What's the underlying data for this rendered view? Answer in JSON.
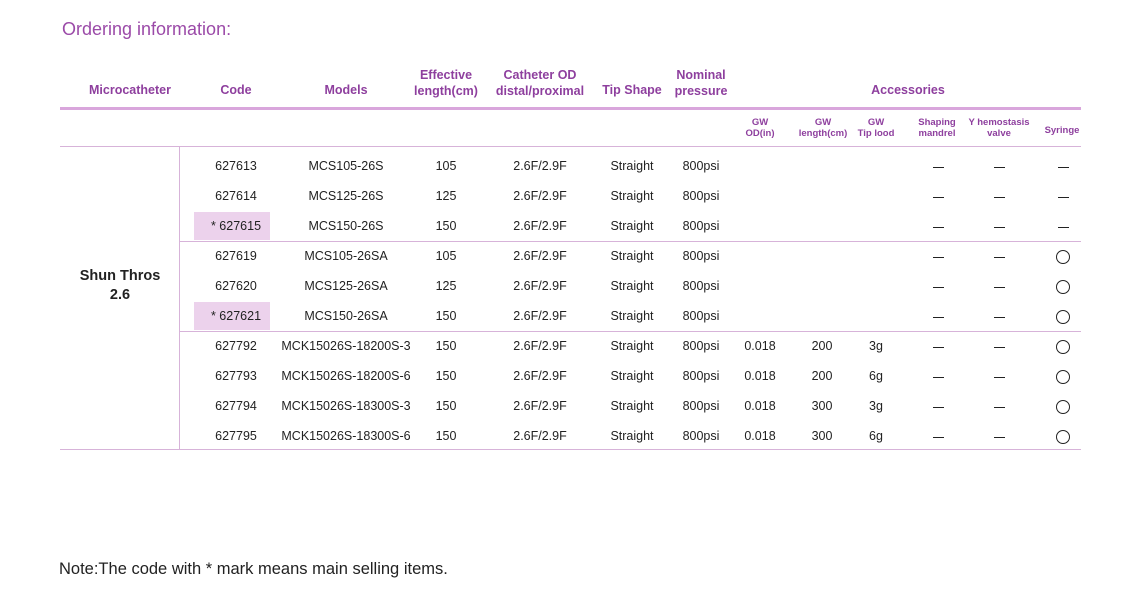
{
  "title": "Ordering information:",
  "headers": {
    "microcatheter": "Microcatheter",
    "code": "Code",
    "models": "Models",
    "effective_length": [
      "Effective",
      "length(cm)"
    ],
    "catheter_od": [
      "Catheter OD",
      "distal/proximal"
    ],
    "tip_shape": "Tip Shape",
    "nominal_pressure": [
      "Nominal",
      "pressure"
    ],
    "accessories": "Accessories"
  },
  "subheaders": {
    "gw_od": [
      "GW",
      "OD(in)"
    ],
    "gw_length": [
      "GW",
      "length(cm)"
    ],
    "gw_tip": [
      "GW",
      "Tip lood"
    ],
    "shaping": [
      "Shaping",
      "mandrel"
    ],
    "y_hemostasis": [
      "Y hemostasis",
      "valve"
    ],
    "syringe": "Syringe"
  },
  "group_label": [
    "Shun Thros",
    "2.6"
  ],
  "rows": [
    {
      "code": "627613",
      "model": "MCS105-26S",
      "length": "105",
      "od": "2.6F/2.9F",
      "tip": "Straight",
      "pressure": "800psi",
      "gw_od": "",
      "gw_len": "",
      "gw_tip": "",
      "shaping": "—",
      "yvalve": "—",
      "syringe": "—",
      "main": false
    },
    {
      "code": "627614",
      "model": "MCS125-26S",
      "length": "125",
      "od": "2.6F/2.9F",
      "tip": "Straight",
      "pressure": "800psi",
      "gw_od": "",
      "gw_len": "",
      "gw_tip": "",
      "shaping": "—",
      "yvalve": "—",
      "syringe": "—",
      "main": false
    },
    {
      "code": "* 627615",
      "model": "MCS150-26S",
      "length": "150",
      "od": "2.6F/2.9F",
      "tip": "Straight",
      "pressure": "800psi",
      "gw_od": "",
      "gw_len": "",
      "gw_tip": "",
      "shaping": "—",
      "yvalve": "—",
      "syringe": "—",
      "main": true
    },
    {
      "code": "627619",
      "model": "MCS105-26SA",
      "length": "105",
      "od": "2.6F/2.9F",
      "tip": "Straight",
      "pressure": "800psi",
      "gw_od": "",
      "gw_len": "",
      "gw_tip": "",
      "shaping": "—",
      "yvalve": "—",
      "syringe": "○",
      "main": false
    },
    {
      "code": "627620",
      "model": "MCS125-26SA",
      "length": "125",
      "od": "2.6F/2.9F",
      "tip": "Straight",
      "pressure": "800psi",
      "gw_od": "",
      "gw_len": "",
      "gw_tip": "",
      "shaping": "—",
      "yvalve": "—",
      "syringe": "○",
      "main": false
    },
    {
      "code": "* 627621",
      "model": "MCS150-26SA",
      "length": "150",
      "od": "2.6F/2.9F",
      "tip": "Straight",
      "pressure": "800psi",
      "gw_od": "",
      "gw_len": "",
      "gw_tip": "",
      "shaping": "—",
      "yvalve": "—",
      "syringe": "○",
      "main": true
    },
    {
      "code": "627792",
      "model": "MCK15026S-18200S-3",
      "length": "150",
      "od": "2.6F/2.9F",
      "tip": "Straight",
      "pressure": "800psi",
      "gw_od": "0.018",
      "gw_len": "200",
      "gw_tip": "3g",
      "shaping": "—",
      "yvalve": "—",
      "syringe": "○",
      "main": false
    },
    {
      "code": "627793",
      "model": "MCK15026S-18200S-6",
      "length": "150",
      "od": "2.6F/2.9F",
      "tip": "Straight",
      "pressure": "800psi",
      "gw_od": "0.018",
      "gw_len": "200",
      "gw_tip": "6g",
      "shaping": "—",
      "yvalve": "—",
      "syringe": "○",
      "main": false
    },
    {
      "code": "627794",
      "model": "MCK15026S-18300S-3",
      "length": "150",
      "od": "2.6F/2.9F",
      "tip": "Straight",
      "pressure": "800psi",
      "gw_od": "0.018",
      "gw_len": "300",
      "gw_tip": "3g",
      "shaping": "—",
      "yvalve": "—",
      "syringe": "○",
      "main": false
    },
    {
      "code": "627795",
      "model": "MCK15026S-18300S-6",
      "length": "150",
      "od": "2.6F/2.9F",
      "tip": "Straight",
      "pressure": "800psi",
      "gw_od": "0.018",
      "gw_len": "300",
      "gw_tip": "6g",
      "shaping": "—",
      "yvalve": "—",
      "syringe": "○",
      "main": false
    }
  ],
  "note": "Note:The code with * mark means main selling items.",
  "colors": {
    "accent": "#8e3f9e",
    "rule": "#d9a6dc",
    "highlight": "#ecd2ec"
  }
}
